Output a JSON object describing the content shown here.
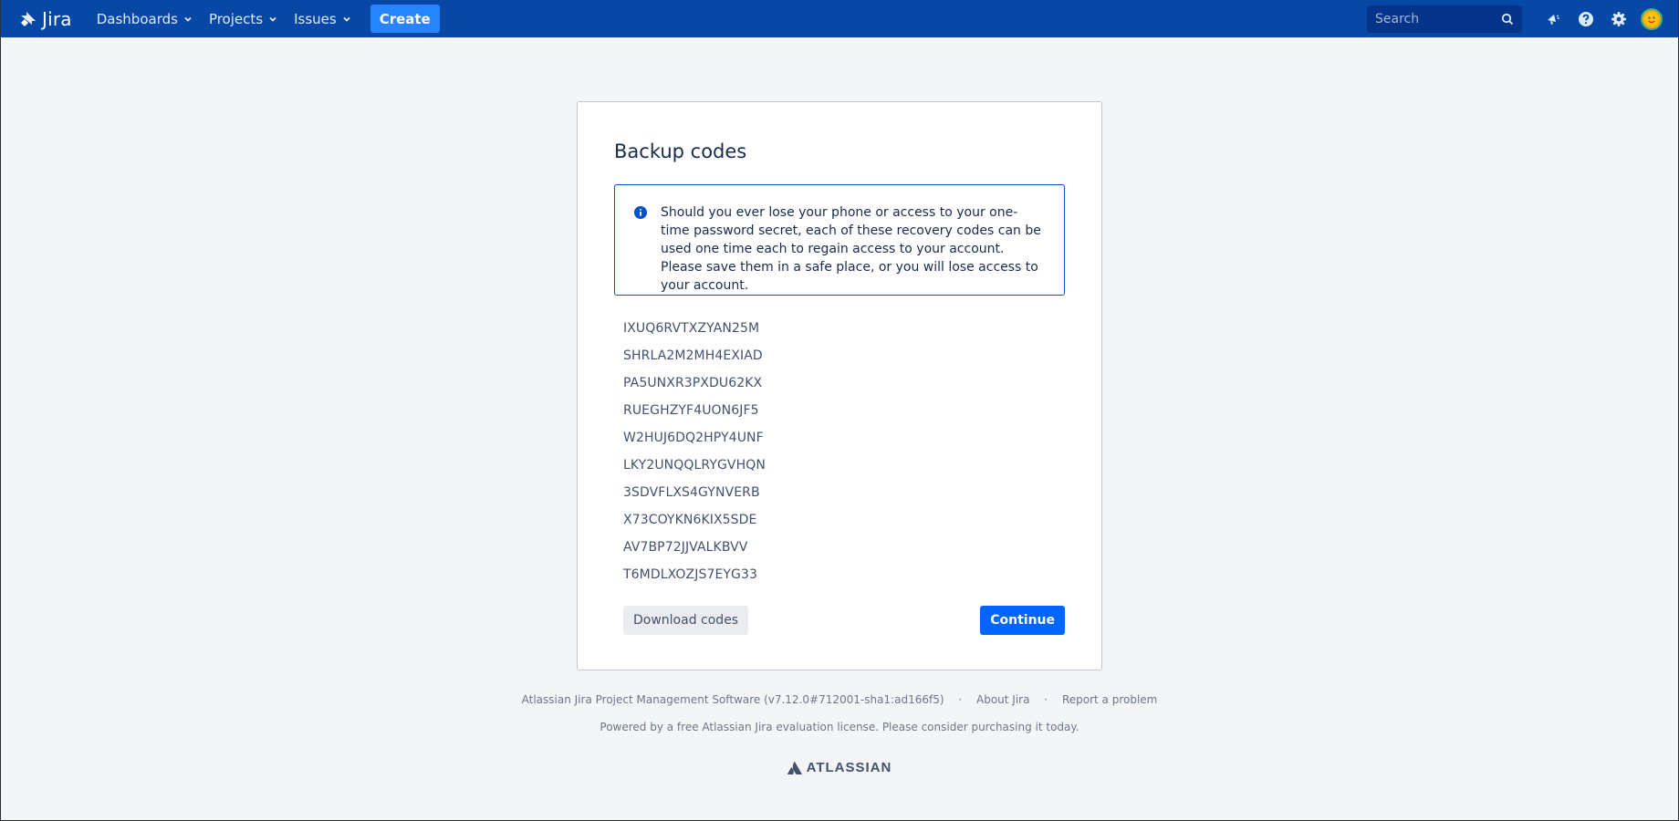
{
  "nav": {
    "logo_text": "Jira",
    "items": [
      {
        "label": "Dashboards"
      },
      {
        "label": "Projects"
      },
      {
        "label": "Issues"
      }
    ],
    "create_label": "Create",
    "search_placeholder": "Search",
    "icons": [
      "notifications-icon",
      "help-icon",
      "settings-icon"
    ]
  },
  "card": {
    "title": "Backup codes",
    "info_text": "Should you ever lose your phone or access to your one-time password secret, each of these recovery codes can be used one time each to regain access to your account. Please save them in a safe place, or you will lose access to your account.",
    "codes": [
      "IXUQ6RVTXZYAN25M",
      "SHRLA2M2MH4EXIAD",
      "PA5UNXR3PXDU62KX",
      "RUEGHZYF4UON6JF5",
      "W2HUJ6DQ2HPY4UNF",
      "LKY2UNQQLRYGVHQN",
      "3SDVFLXS4GYNVERB",
      "X73COYKN6KIX5SDE",
      "AV7BP72JJVALKBVV",
      "T6MDLXOZJS7EYG33"
    ],
    "download_label": "Download codes",
    "continue_label": "Continue"
  },
  "footer": {
    "software": "Atlassian Jira Project Management Software (v7.12.0#712001-sha1:ad166f5)",
    "separator": "·",
    "about": "About Jira",
    "report": "Report a problem",
    "license": "Powered by a free Atlassian Jira evaluation license. Please consider purchasing it today.",
    "brand": "ATLASSIAN"
  },
  "colors": {
    "nav_bg": "#0747a6",
    "create_btn": "#2684ff",
    "primary_btn": "#0065ff",
    "info_border": "#0052cc"
  }
}
